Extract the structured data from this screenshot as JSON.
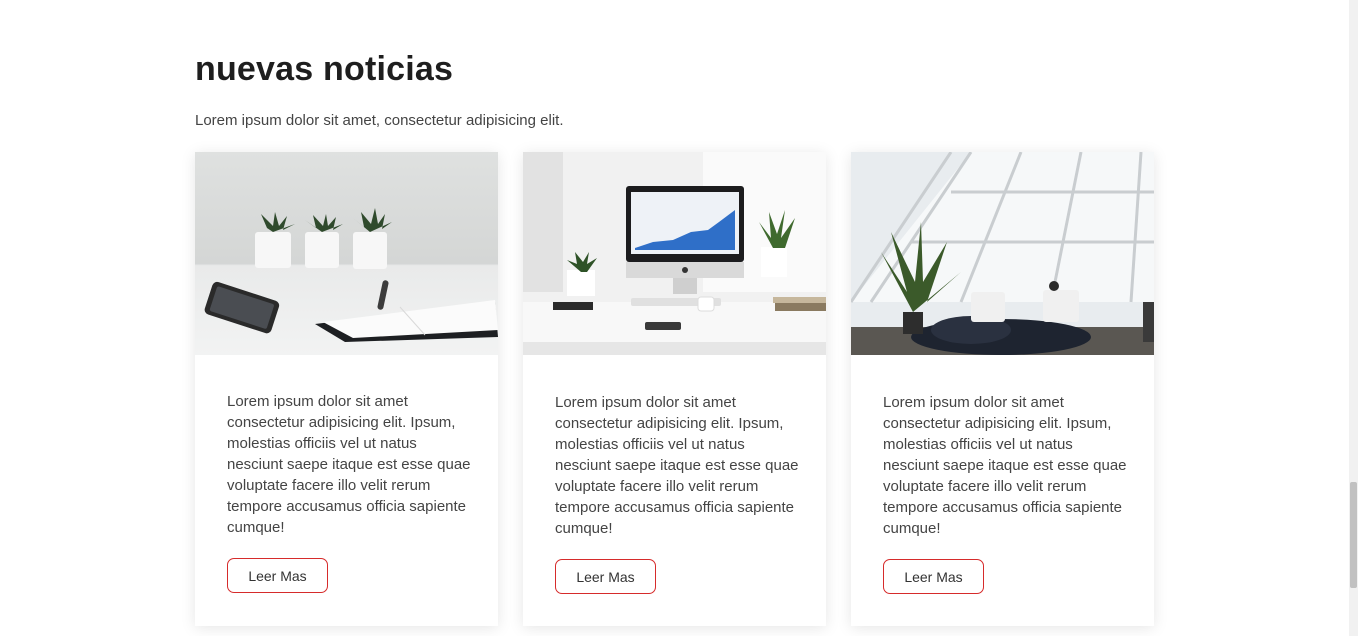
{
  "news": {
    "title": "nuevas noticias",
    "subtitle": "Lorem ipsum dolor sit amet, consectetur adipisicing elit.",
    "cards": [
      {
        "image": "desk-plants-phone-notebook-photo",
        "text": "Lorem ipsum dolor sit amet consectetur adipisicing elit. Ipsum, molestias officiis vel ut natus nesciunt saepe itaque est esse quae voluptate facere illo velit rerum tempore accusamus officia sapiente cumque!",
        "button": "Leer Mas"
      },
      {
        "image": "computer-desk-workspace-photo",
        "text": "Lorem ipsum dolor sit amet consectetur adipisicing elit. Ipsum, molestias officiis vel ut natus nesciunt saepe itaque est esse quae voluptate facere illo velit rerum tempore accusamus officia sapiente cumque!",
        "button": "Leer Mas"
      },
      {
        "image": "office-lounge-photo",
        "text": "Lorem ipsum dolor sit amet consectetur adipisicing elit. Ipsum, molestias officiis vel ut natus nesciunt saepe itaque est esse quae voluptate facere illo velit rerum tempore accusamus officia sapiente cumque!",
        "button": "Leer Mas"
      }
    ]
  },
  "colors": {
    "accent": "#d62b2b",
    "heading": "#1e1e1e",
    "text": "#444444"
  }
}
